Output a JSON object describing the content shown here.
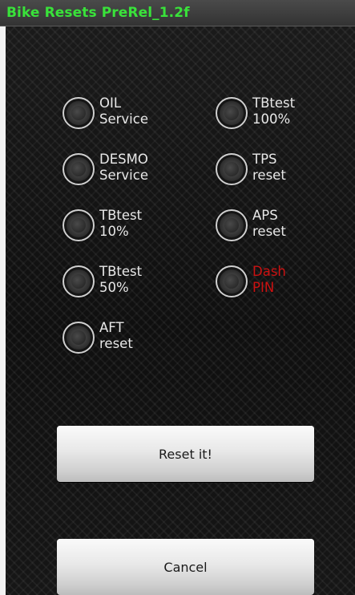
{
  "title_bar": {
    "title": "Bike Resets PreRel_1.2f",
    "title_color": "#39e23a"
  },
  "options": {
    "oil_service": {
      "line1": "OIL",
      "line2": "Service"
    },
    "desmo_service": {
      "line1": "DESMO",
      "line2": "Service"
    },
    "tbtest_10": {
      "line1": "TBtest",
      "line2": "10%"
    },
    "tbtest_50": {
      "line1": "TBtest",
      "line2": "50%"
    },
    "aft_reset": {
      "line1": "AFT",
      "line2": "reset"
    },
    "tbtest_100": {
      "line1": "TBtest",
      "line2": "100%"
    },
    "tps_reset": {
      "line1": "TPS",
      "line2": "reset"
    },
    "aps_reset": {
      "line1": "APS",
      "line2": "reset"
    },
    "dash_pin": {
      "line1": "Dash",
      "line2": "PIN",
      "label_color": "#cc1111"
    }
  },
  "buttons": {
    "reset_label": "Reset it!",
    "cancel_label": "Cancel"
  }
}
